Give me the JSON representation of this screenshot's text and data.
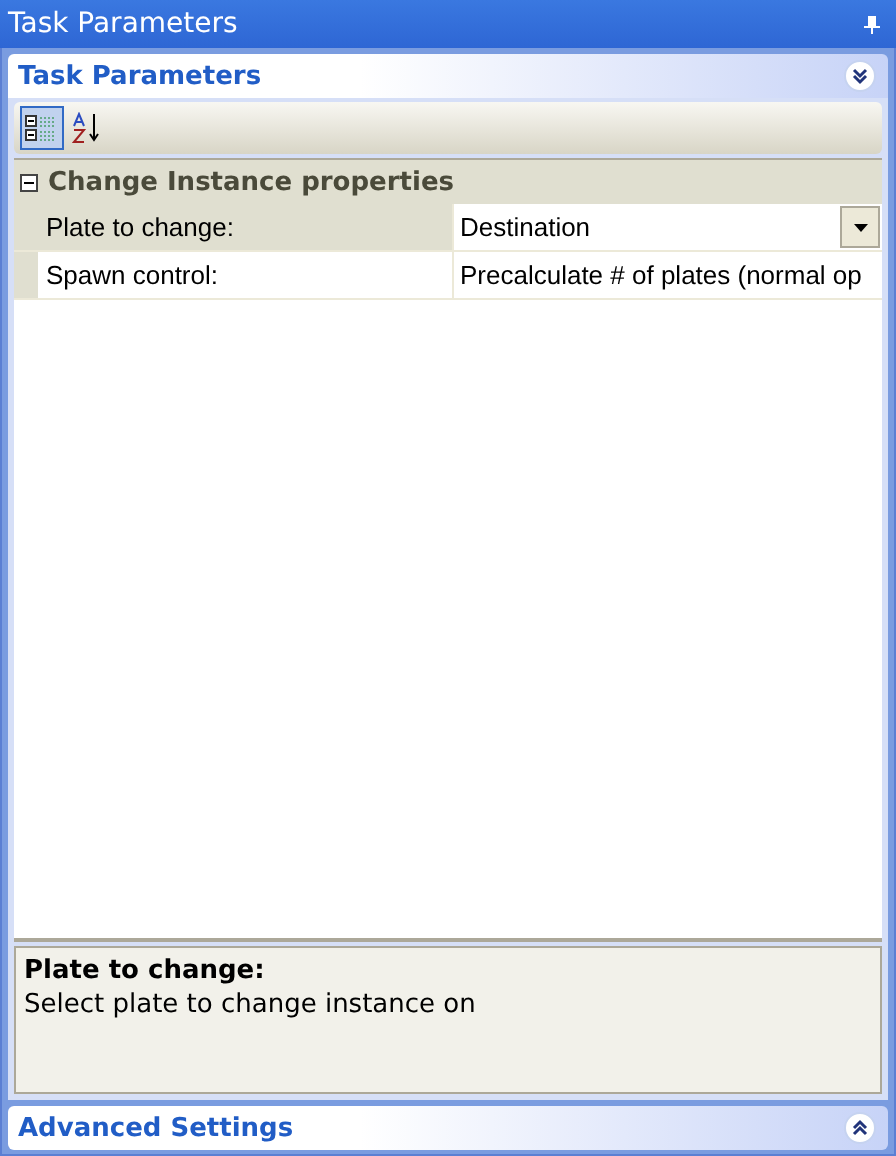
{
  "window": {
    "title": "Task Parameters"
  },
  "sections": [
    {
      "title": "Task Parameters",
      "expanded": true
    },
    {
      "title": "Advanced Settings",
      "expanded": false
    }
  ],
  "toolbar": [
    {
      "kind": "categorized",
      "selected": true
    },
    {
      "kind": "alphabetical",
      "selected": false
    }
  ],
  "category": {
    "title": "Change Instance properties",
    "expanded": true
  },
  "properties": [
    {
      "name": "Plate to change:",
      "value": "Destination",
      "selected": true
    },
    {
      "name": "Spawn control:",
      "value": "Precalculate # of plates (normal op",
      "selected": false
    }
  ],
  "description": {
    "title": "Plate to change:",
    "text": "Select plate to change instance on"
  }
}
